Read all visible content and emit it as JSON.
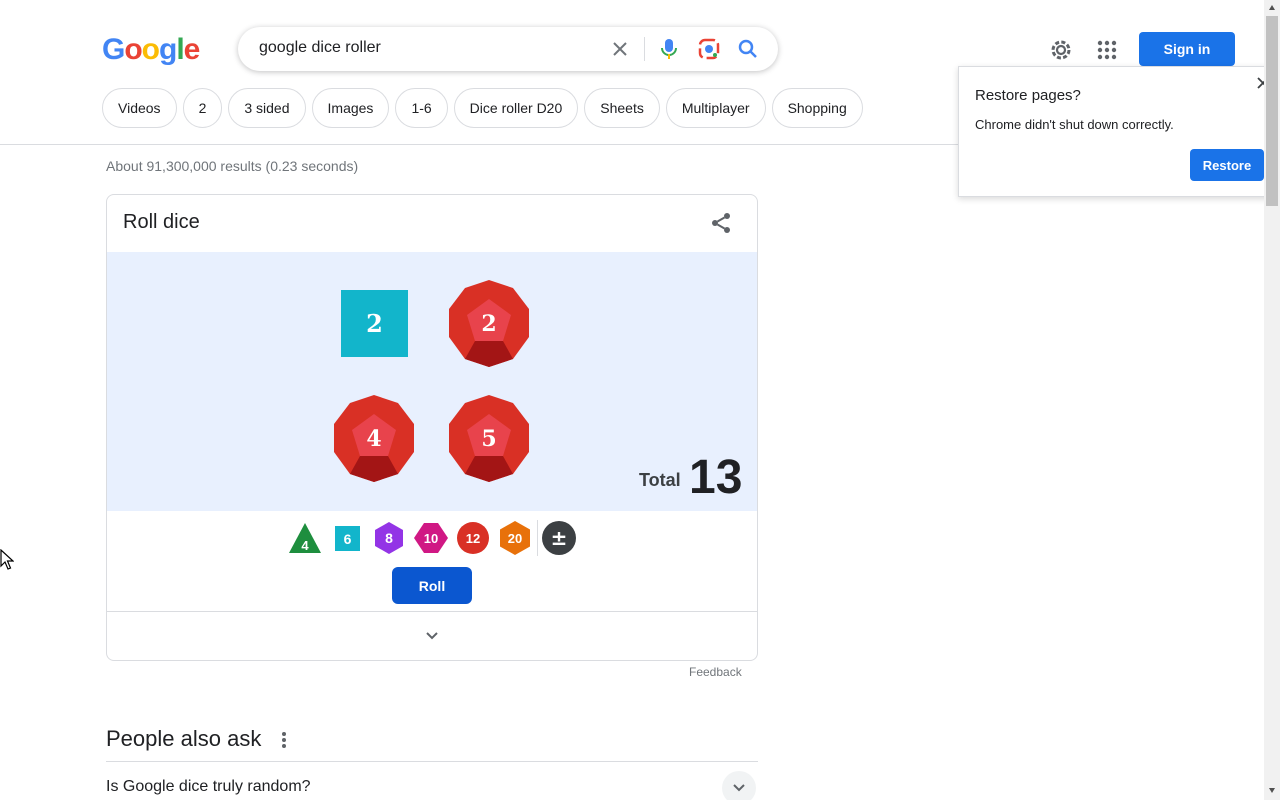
{
  "header": {
    "logo_letters": [
      {
        "char": "G",
        "color": "#4285F4"
      },
      {
        "char": "o",
        "color": "#EA4335"
      },
      {
        "char": "o",
        "color": "#FBBC05"
      },
      {
        "char": "g",
        "color": "#4285F4"
      },
      {
        "char": "l",
        "color": "#34A853"
      },
      {
        "char": "e",
        "color": "#EA4335"
      }
    ],
    "search_query": "google dice roller",
    "signin_label": "Sign in"
  },
  "chips": [
    "Videos",
    "2",
    "3 sided",
    "Images",
    "1-6",
    "Dice roller D20",
    "Sheets",
    "Multiplayer",
    "Shopping"
  ],
  "results_count": "About 91,300,000 results (0.23 seconds)",
  "dice_card": {
    "title": "Roll dice",
    "dice": [
      {
        "type": "d6",
        "value": "2"
      },
      {
        "type": "d12",
        "value": "2"
      },
      {
        "type": "d12",
        "value": "4"
      },
      {
        "type": "d12",
        "value": "5"
      }
    ],
    "total_label": "Total",
    "total_value": "13",
    "picker": [
      {
        "label": "4",
        "shape": "triangle",
        "color": "#1e8e3e"
      },
      {
        "label": "6",
        "shape": "square",
        "color": "#12b5cb"
      },
      {
        "label": "8",
        "shape": "hexagon",
        "color": "#9334e6"
      },
      {
        "label": "10",
        "shape": "diamond-hex",
        "color": "#d01884"
      },
      {
        "label": "12",
        "shape": "circle",
        "color": "#d93025"
      },
      {
        "label": "20",
        "shape": "hexagon",
        "color": "#e8710a"
      },
      {
        "label": "±",
        "shape": "circle",
        "color": "#3c4043"
      }
    ],
    "roll_label": "Roll"
  },
  "feedback_label": "Feedback",
  "people_also_ask": {
    "title": "People also ask",
    "questions": [
      "Is Google dice truly random?"
    ]
  },
  "restore_popup": {
    "title": "Restore pages?",
    "message": "Chrome didn't shut down correctly.",
    "button_label": "Restore"
  },
  "colors": {
    "accent_blue": "#1a73e8",
    "roll_blue": "#0b57d0",
    "die_red": "#d93025",
    "die_teal": "#12b5cb",
    "stage_bg": "#e8f0fe"
  }
}
